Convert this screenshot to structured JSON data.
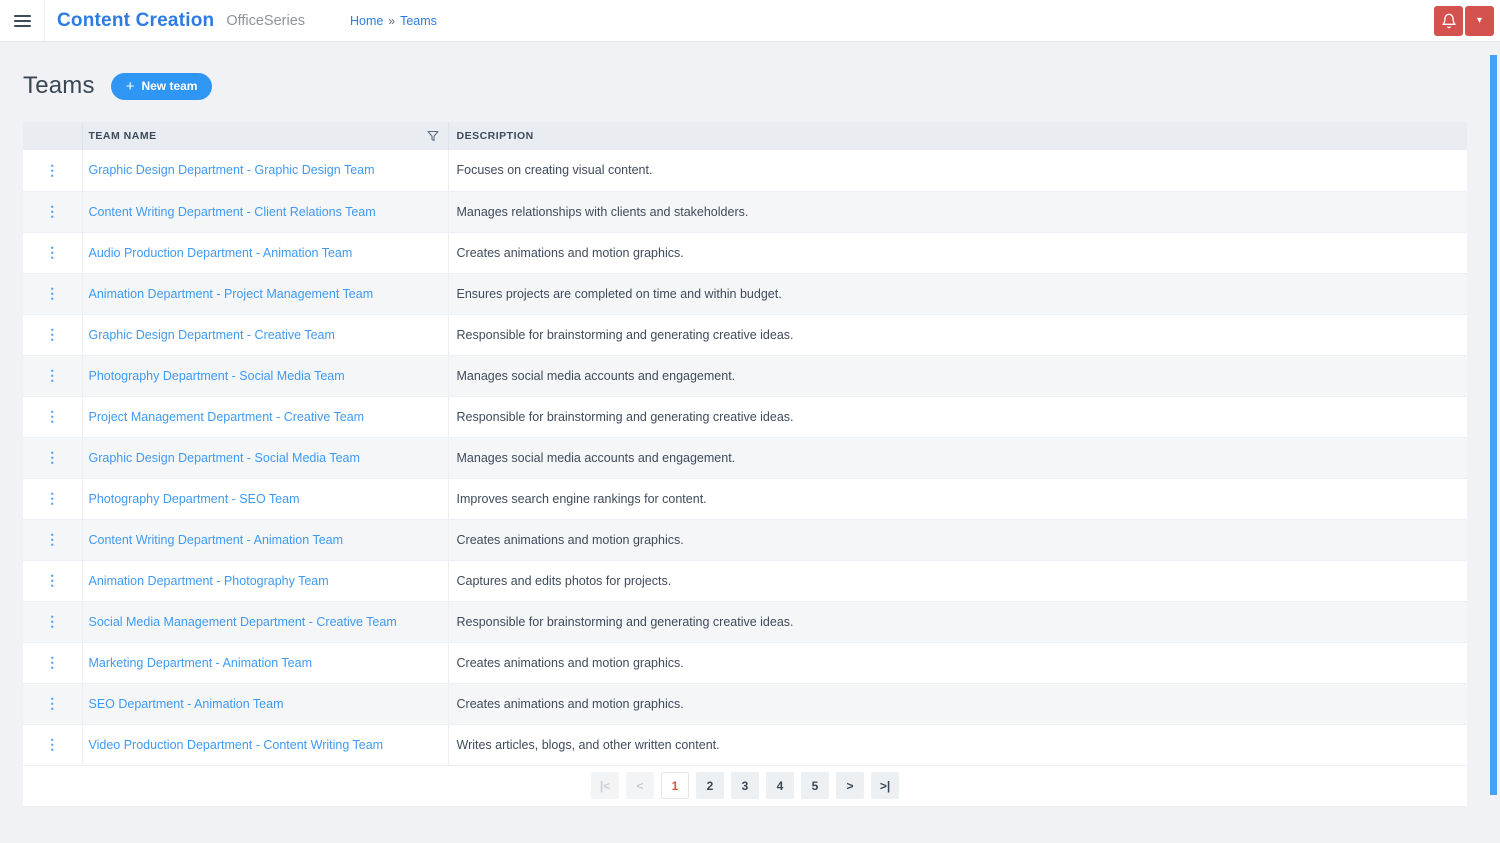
{
  "header": {
    "app_title": "Content Creation",
    "app_subtitle": "OfficeSeries",
    "breadcrumb": {
      "home": "Home",
      "separator": "»",
      "current": "Teams"
    }
  },
  "page": {
    "title": "Teams",
    "new_team_label": "New team"
  },
  "icons": {
    "kebab": "⋮",
    "plus": "+",
    "caret": "▾"
  },
  "table": {
    "columns": {
      "name": "TEAM NAME",
      "description": "DESCRIPTION"
    },
    "rows": [
      {
        "name": "Graphic Design Department - Graphic Design Team",
        "description": "Focuses on creating visual content."
      },
      {
        "name": "Content Writing Department - Client Relations Team",
        "description": "Manages relationships with clients and stakeholders."
      },
      {
        "name": "Audio Production Department - Animation Team",
        "description": "Creates animations and motion graphics."
      },
      {
        "name": "Animation Department - Project Management Team",
        "description": "Ensures projects are completed on time and within budget."
      },
      {
        "name": "Graphic Design Department - Creative Team",
        "description": "Responsible for brainstorming and generating creative ideas."
      },
      {
        "name": "Photography Department - Social Media Team",
        "description": "Manages social media accounts and engagement."
      },
      {
        "name": "Project Management Department - Creative Team",
        "description": "Responsible for brainstorming and generating creative ideas."
      },
      {
        "name": "Graphic Design Department - Social Media Team",
        "description": "Manages social media accounts and engagement."
      },
      {
        "name": "Photography Department - SEO Team",
        "description": "Improves search engine rankings for content."
      },
      {
        "name": "Content Writing Department - Animation Team",
        "description": "Creates animations and motion graphics."
      },
      {
        "name": "Animation Department - Photography Team",
        "description": "Captures and edits photos for projects."
      },
      {
        "name": "Social Media Management Department - Creative Team",
        "description": "Responsible for brainstorming and generating creative ideas."
      },
      {
        "name": "Marketing Department - Animation Team",
        "description": "Creates animations and motion graphics."
      },
      {
        "name": "SEO Department - Animation Team",
        "description": "Creates animations and motion graphics."
      },
      {
        "name": "Video Production Department - Content Writing Team",
        "description": "Writes articles, blogs, and other written content."
      }
    ]
  },
  "pagination": {
    "first_label": "|<",
    "prev_label": "<",
    "pages": [
      "1",
      "2",
      "3",
      "4",
      "5"
    ],
    "active_page": "1",
    "next_label": ">",
    "last_label": ">|"
  },
  "colors": {
    "brand_blue": "#2d7ce2",
    "accent_blue": "#2f97f3",
    "link_blue": "#3e9af4",
    "danger_red": "#d4524e",
    "active_page_text": "#dc5347",
    "header_bg": "#e9edf2",
    "page_bg": "#f0f2f5",
    "scrollbar_blue": "#45a1f5"
  }
}
